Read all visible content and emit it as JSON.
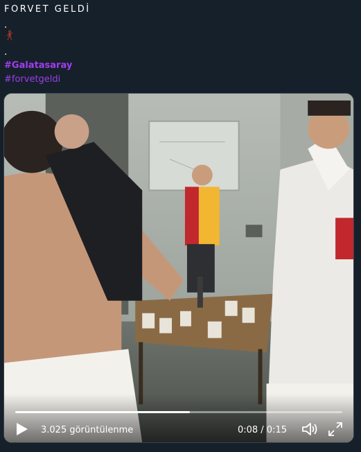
{
  "tweet": {
    "headline": "FORVET GELDİ",
    "dot1": ".",
    "dot2": ".",
    "emoji": "runner-emoji",
    "hashtags": [
      "#Galatasaray",
      "#forvetgeldi"
    ]
  },
  "video": {
    "views": "3.025 görüntülenme",
    "time": "0:08 / 0:15",
    "progress": 0.533,
    "icons": {
      "play": "play-icon",
      "volume": "volume-icon",
      "fullscreen": "fullscreen-icon"
    }
  },
  "colors": {
    "background": "#15202b",
    "hashtag": "#9b3fe6",
    "team_red": "#c0282d",
    "team_yellow": "#f2b632"
  }
}
